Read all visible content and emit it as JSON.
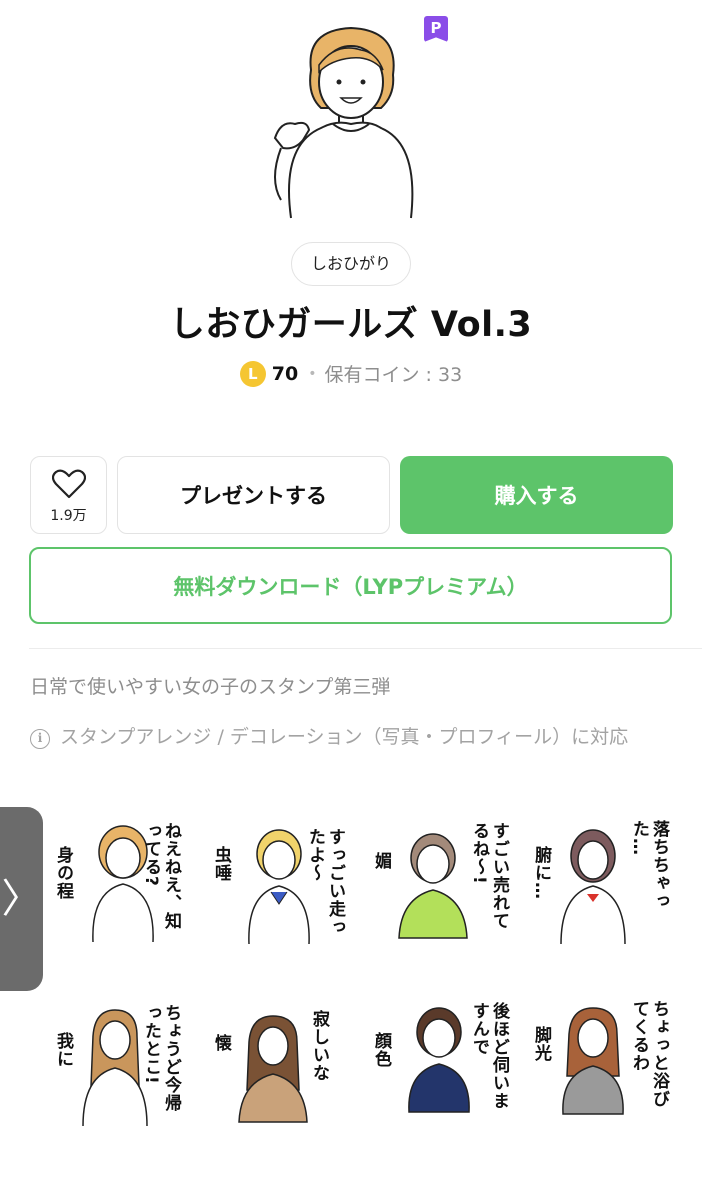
{
  "header": {
    "premium_badge": "P",
    "hero_icon": "girl-illustration"
  },
  "author": "しおひがり",
  "title": "しおひガールズ Vol.3",
  "price": {
    "coin_symbol": "L",
    "amount": "70",
    "separator": "•",
    "owned_coins": "保有コイン : 33"
  },
  "actions": {
    "like_icon": "heart-icon",
    "like_count": "1.9万",
    "present_label": "プレゼントする",
    "buy_label": "購入する",
    "download_label": "無料ダウンロード（LYPプレミアム）"
  },
  "description": "日常で使いやすい女の子のスタンプ第三弾",
  "info": {
    "icon_text": "i",
    "note": "スタンプアレンジ / デコレーション（写真・プロフィール）に対応"
  },
  "stickers": [
    {
      "caps": [
        "身の程",
        "ねえねえ、知ってる?"
      ]
    },
    {
      "caps": [
        "虫唾",
        "すっごい走ったよ〜"
      ]
    },
    {
      "caps": [
        "媚",
        "すごい売れてるね〜!"
      ]
    },
    {
      "caps": [
        "腑に…",
        "落ちちゃった…"
      ]
    },
    {
      "caps": [
        "我に",
        "ちょうど今帰ったとこ!"
      ]
    },
    {
      "caps": [
        "懐",
        "寂しいな"
      ]
    },
    {
      "caps": [
        "顔色",
        "後ほど伺いますんで"
      ]
    },
    {
      "caps": [
        "脚光",
        "ちょっと浴びてくるわ"
      ]
    }
  ],
  "side_tab": "〉",
  "colors": {
    "accent_green": "#5dc46a",
    "premium_purple": "#8a4de8",
    "coin_yellow": "#f5c632",
    "muted_gray": "#8e8e8e"
  }
}
